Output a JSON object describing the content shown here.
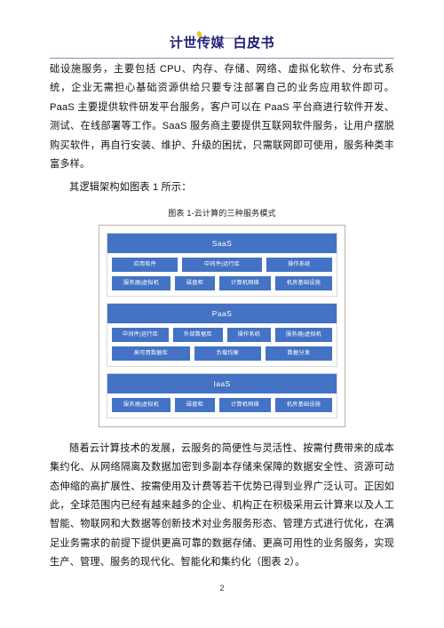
{
  "header": {
    "brand": "计世传媒",
    "brand_micro": "CHINA COMPUTERWORLD",
    "doc_type": "白皮书"
  },
  "body": {
    "paragraph_1": "础设施服务，主要包括 CPU、内存、存储、网络、虚拟化软件、分布式系统，企业无需担心基础资源供给只要专注部署自己的业务应用软件即可。PaaS 主要提供软件研发平台服务，客户可以在 PaaS 平台商进行软件开发、测试、在线部署等工作。SaaS 服务商主要提供互联网软件服务，让用户摆脱购买软件，再自行安装、维护、升级的困扰，只需联网即可使用，服务种类丰富多样。",
    "paragraph_2": "其逻辑架构如图表 1 所示：",
    "paragraph_3": "随着云计算技术的发展，云服务的简便性与灵活性、按需付费带来的成本集约化、从网络隔离及数据加密到多副本存储来保障的数据安全性、资源可动态伸缩的高扩展性、按需使用及计费等若干优势已得到业界广泛认可。正因如此，全球范围内已经有越来越多的企业、机构正在积极采用云计算来以及人工智能、物联网和大数据等创新技术对业务服务形态、管理方式进行优化，在满足业务需求的前提下提供更高可靠的数据存储、更高可用性的业务服务，实现生产、管理、服务的现代化、智能化和集约化（图表 2）。"
  },
  "figure": {
    "caption": "图表 1-云计算的三种服务模式",
    "accent_color": "#4472C4",
    "frame_color": "#b9b2a8",
    "layers": [
      {
        "title": "SaaS",
        "rows": [
          [
            "应用软件",
            "中间件|运行库",
            "操作系统"
          ],
          [
            "服务器|虚拟机",
            "磁盘柜",
            "计算机网络",
            "机房基础设施"
          ]
        ]
      },
      {
        "title": "PaaS",
        "rows": [
          [
            "中间件|运行库",
            "外部数据库",
            "操作系统",
            "服务器|虚拟机"
          ],
          [
            "高可用数据库",
            "负载均衡",
            "数据分发"
          ]
        ]
      },
      {
        "title": "IaaS",
        "rows": [
          [
            "服务器|虚拟机",
            "磁盘柜",
            "计算机网络",
            "机房基础设施"
          ]
        ]
      }
    ]
  },
  "footer": {
    "page_number": "2"
  }
}
